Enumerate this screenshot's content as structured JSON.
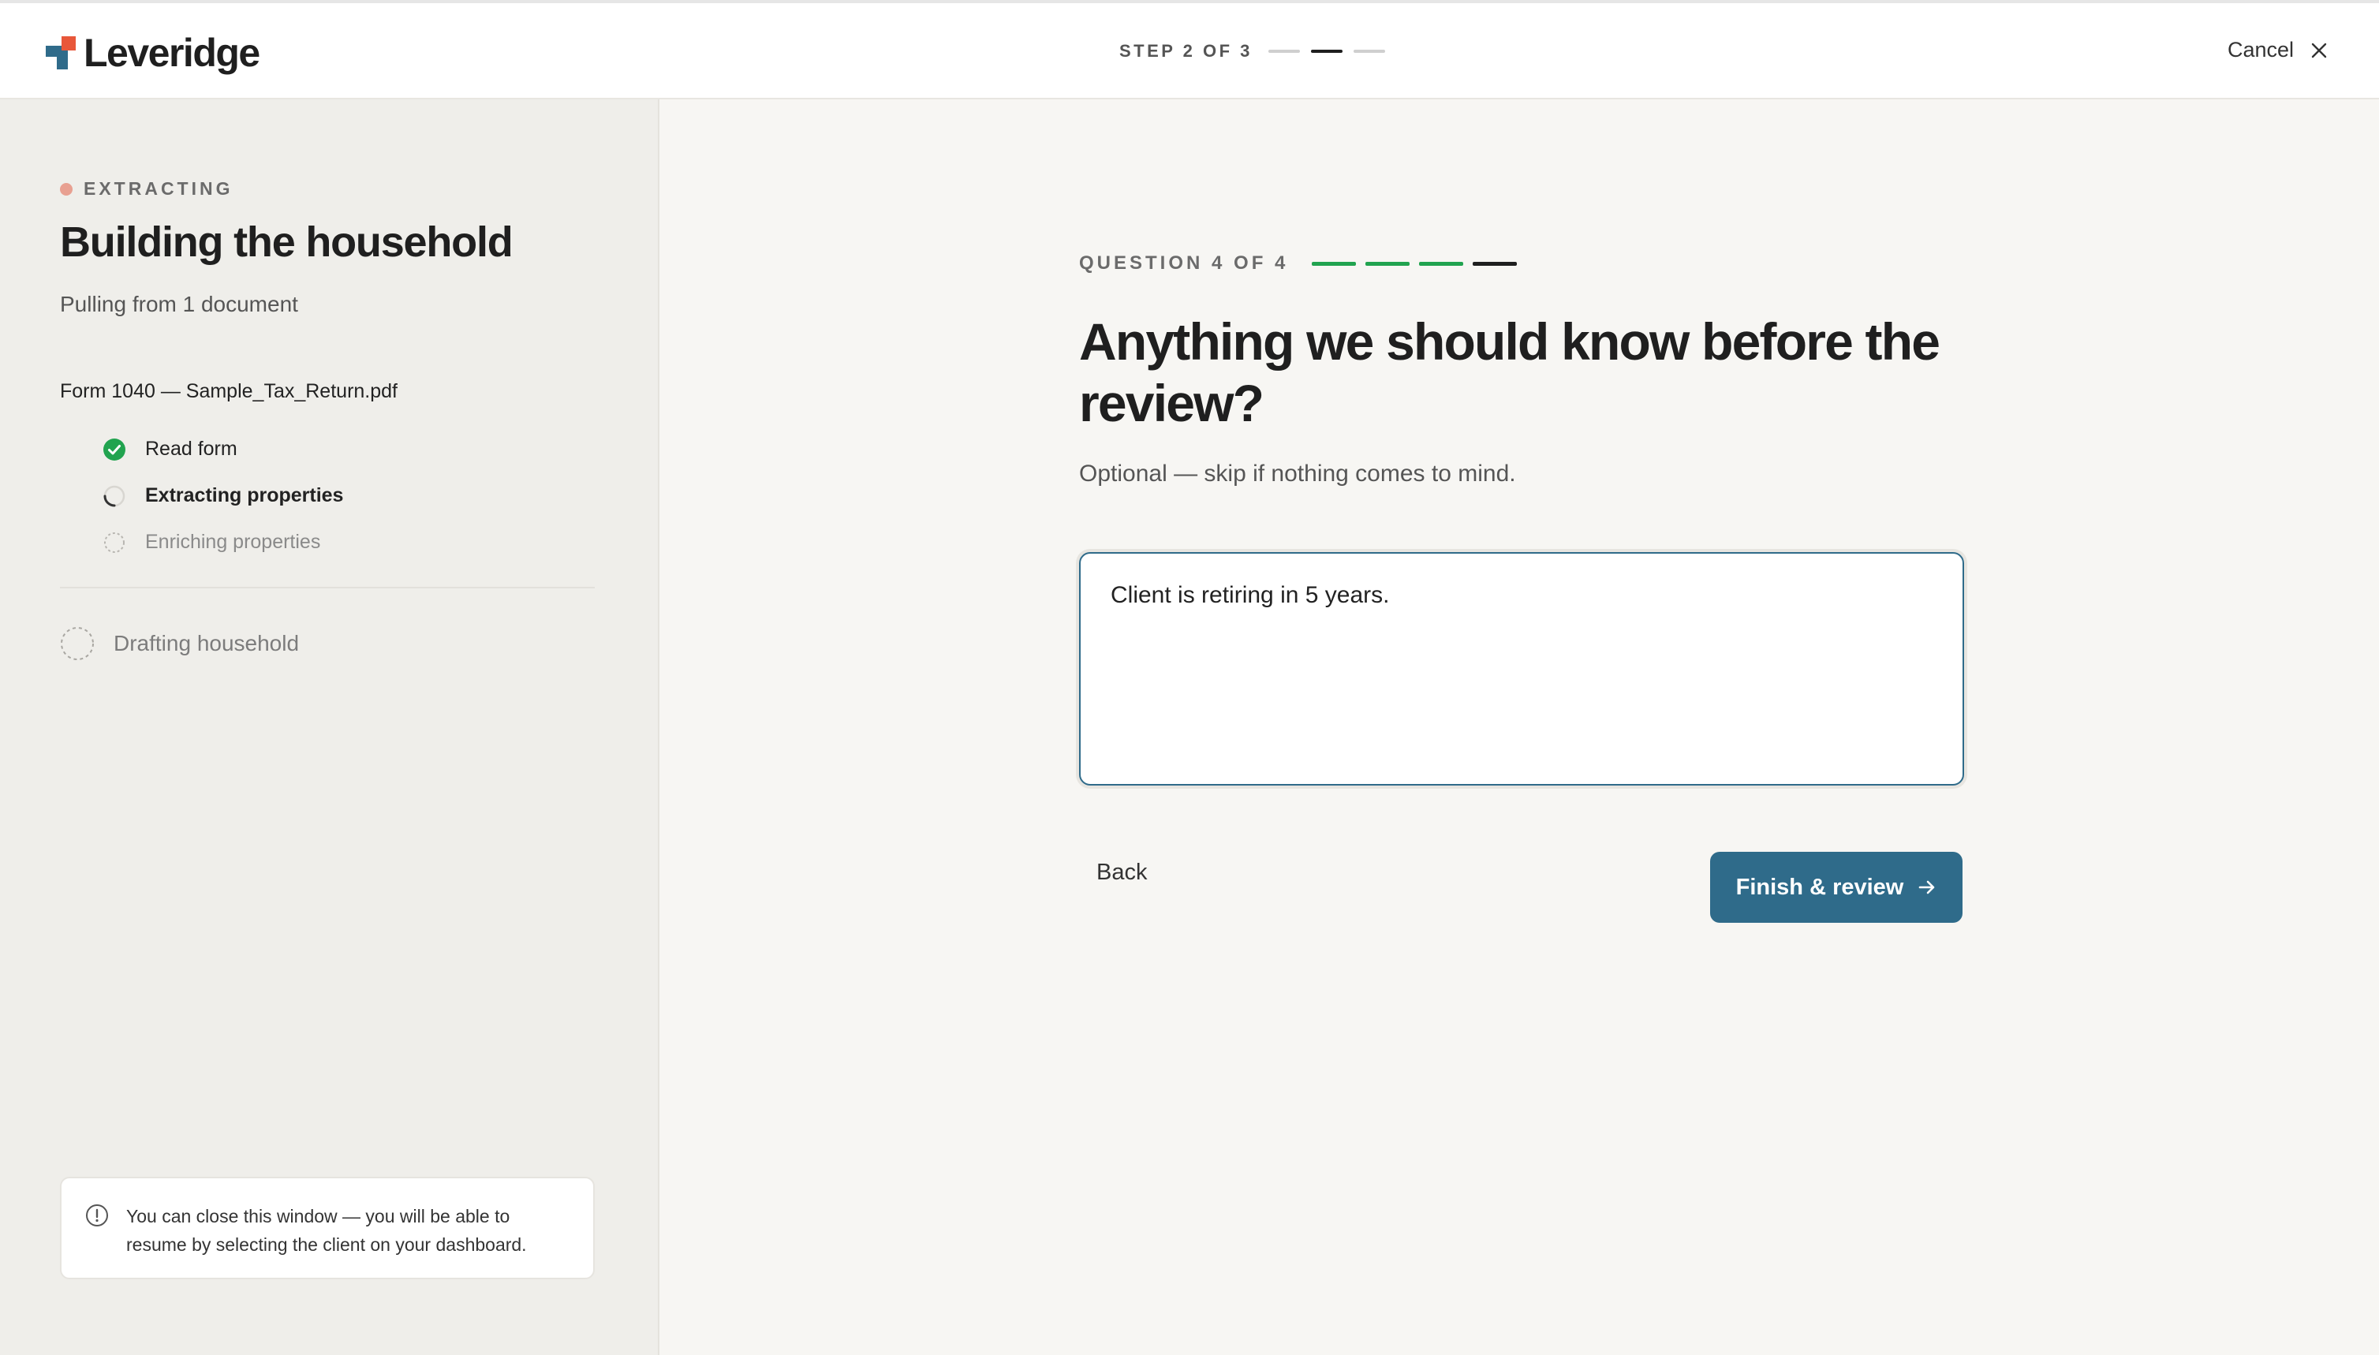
{
  "header": {
    "brand": "Leveridge",
    "step_text": "STEP 2 OF 3",
    "step_total": 3,
    "step_current": 2,
    "cancel_label": "Cancel"
  },
  "sidebar": {
    "status_label": "EXTRACTING",
    "title": "Building the household",
    "subtitle": "Pulling from 1 document",
    "document_name": "Form 1040 — Sample_Tax_Return.pdf",
    "tasks": [
      {
        "label": "Read form",
        "state": "done"
      },
      {
        "label": "Extracting properties",
        "state": "in-progress"
      },
      {
        "label": "Enriching properties",
        "state": "pending"
      }
    ],
    "phase_label": "Drafting household",
    "info_text": "You can close this window — you will be able to resume by selecting the client on your dashboard."
  },
  "main": {
    "question_counter": "QUESTION 4 OF 4",
    "question_total": 4,
    "question_current": 4,
    "question_title": "Anything we should know before the review?",
    "hint": "Optional — skip if nothing comes to mind.",
    "answer_value": "Client is retiring in 5 years.",
    "back_label": "Back",
    "finish_label": "Finish & review"
  },
  "colors": {
    "accent": "#2f6b8a",
    "brand_orange": "#e8573a",
    "progress_green": "#21a34f",
    "status_dot": "#e8a091"
  }
}
